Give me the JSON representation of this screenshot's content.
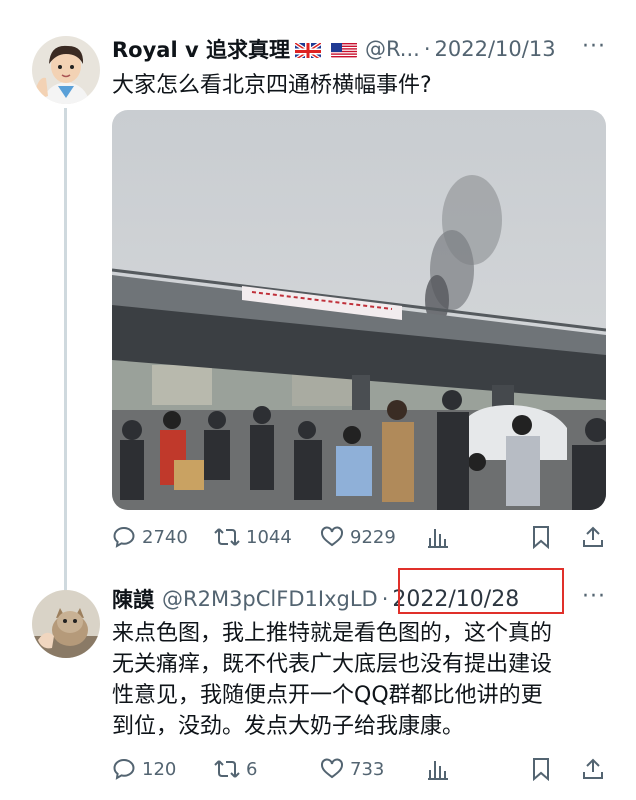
{
  "tweet1": {
    "display_name": "Royal v 追求真理",
    "handle": "@R...",
    "dot": "·",
    "date": "2022/10/13",
    "more": "···",
    "text": "大家怎么看北京四通桥横幅事件?",
    "flags": [
      "uk-flag",
      "us-flag"
    ],
    "stats": {
      "replies": "2740",
      "retweets": "1044",
      "likes": "9229"
    }
  },
  "tweet2": {
    "display_name": "陳謨",
    "handle": "@R2M3pClFD1IxgLD",
    "dot": "·",
    "date": "2022/10/28",
    "more": "···",
    "text_lines": [
      "来点色图，我上推特就是看色图的，这个真的",
      "无关痛痒，既不代表广大底层也没有提出建设",
      "性意见，我随便点开一个QQ群都比他讲的更",
      "到位，没劲。发点大奶子给我康康。"
    ],
    "stats": {
      "replies": "120",
      "retweets": "6",
      "likes": "733"
    }
  },
  "colors": {
    "text": "#0f1419",
    "secondary": "#536471",
    "thread_line": "#cfd9de",
    "highlight_box": "#e0302a"
  },
  "icons": [
    "reply-icon",
    "retweet-icon",
    "like-icon",
    "views-icon",
    "bookmark-icon",
    "share-icon"
  ]
}
